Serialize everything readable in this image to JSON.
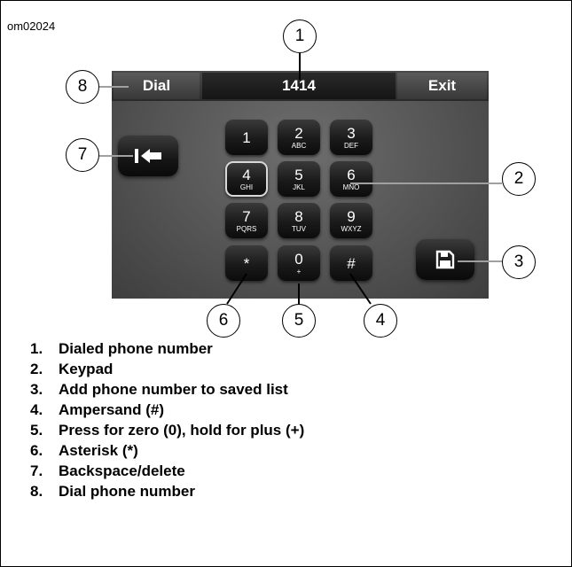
{
  "figure_id": "om02024",
  "topbar": {
    "dial_label": "Dial",
    "number": "1414",
    "exit_label": "Exit"
  },
  "keypad": [
    {
      "digit": "1",
      "letters": ""
    },
    {
      "digit": "2",
      "letters": "ABC"
    },
    {
      "digit": "3",
      "letters": "DEF"
    },
    {
      "digit": "4",
      "letters": "GHI",
      "selected": true
    },
    {
      "digit": "5",
      "letters": "JKL"
    },
    {
      "digit": "6",
      "letters": "MNO"
    },
    {
      "digit": "7",
      "letters": "PQRS"
    },
    {
      "digit": "8",
      "letters": "TUV"
    },
    {
      "digit": "9",
      "letters": "WXYZ"
    },
    {
      "digit": "*",
      "letters": ""
    },
    {
      "digit": "0",
      "letters": "+"
    },
    {
      "digit": "#",
      "letters": ""
    }
  ],
  "icons": {
    "backspace": "backspace-arrow-icon",
    "save": "floppy-disk-save-icon"
  },
  "callouts": [
    "1",
    "2",
    "3",
    "4",
    "5",
    "6",
    "7",
    "8"
  ],
  "legend": [
    {
      "num": "1.",
      "text": "Dialed phone number"
    },
    {
      "num": "2.",
      "text": "Keypad"
    },
    {
      "num": "3.",
      "text": "Add phone number to saved list"
    },
    {
      "num": "4.",
      "text": "Ampersand (#)"
    },
    {
      "num": "5.",
      "text": "Press for zero (0), hold for plus (+)"
    },
    {
      "num": "6.",
      "text": "Asterisk (*)"
    },
    {
      "num": "7.",
      "text": "Backspace/delete"
    },
    {
      "num": "8.",
      "text": "Dial phone number"
    }
  ]
}
